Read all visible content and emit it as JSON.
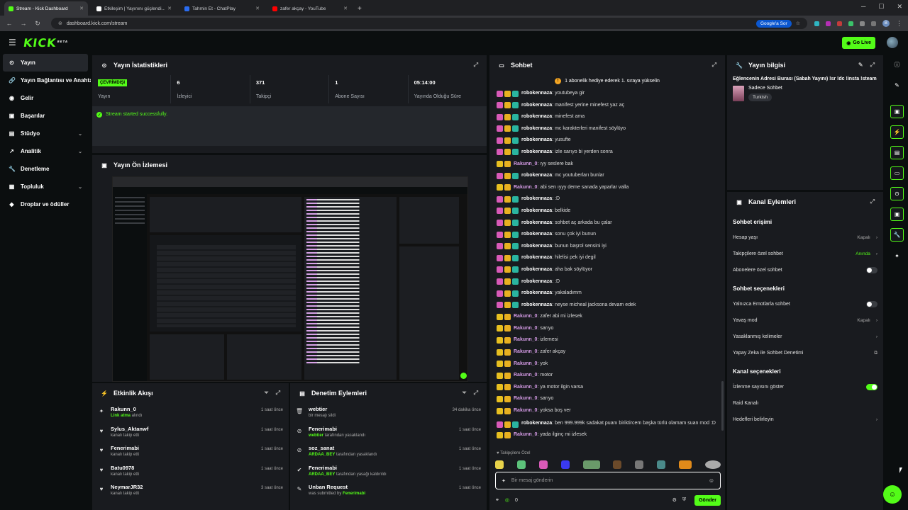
{
  "browser": {
    "tabs": [
      {
        "title": "Stream - Kick Dashboard",
        "fav": "#53fc18",
        "active": true
      },
      {
        "title": "Etkileşim | Yayınını güçlendi...",
        "fav": "#ffffff",
        "active": false
      },
      {
        "title": "Tahmin Et - ChatPlay",
        "fav": "#2a6cf0",
        "active": false
      },
      {
        "title": "zafer akçay - YouTube",
        "fav": "#ff0000",
        "active": false
      }
    ],
    "url": "dashboard.kick.com/stream",
    "google_button": "Google'a Sor",
    "profile_initial": "B"
  },
  "header": {
    "logo": "KICK",
    "logo_sup": "BETA",
    "go_live": "Go Live"
  },
  "sidebar": {
    "items": [
      {
        "label": "Yayın",
        "icon": "⊙",
        "active": true
      },
      {
        "label": "Yayın Bağlantısı ve Anahtarı",
        "icon": "🔗"
      },
      {
        "label": "Gelir",
        "icon": "◉"
      },
      {
        "label": "Başarılar",
        "icon": "▣"
      },
      {
        "label": "Stüdyo",
        "icon": "▤",
        "chevron": true
      },
      {
        "label": "Analitik",
        "icon": "↗",
        "chevron": true
      },
      {
        "label": "Denetleme",
        "icon": "🔧"
      },
      {
        "label": "Topluluk",
        "icon": "▦",
        "chevron": true
      },
      {
        "label": "Droplar ve ödüller",
        "icon": "◆"
      }
    ]
  },
  "stats": {
    "title": "Yayın İstatistikleri",
    "status_badge": "ÇEVRİMDIŞI",
    "status_label": "Yayın",
    "items": [
      {
        "value": "6",
        "label": "İzleyici"
      },
      {
        "value": "371",
        "label": "Takipçi"
      },
      {
        "value": "1",
        "label": "Abone Sayısı"
      },
      {
        "value": "05:14:00",
        "label": "Yayında Olduğu Süre"
      }
    ],
    "message": "Stream started successfully."
  },
  "preview": {
    "title": "Yayın Ön İzlemesi"
  },
  "activity": {
    "title": "Etkinlik Akışı",
    "items": [
      {
        "name": "Rakunn_0",
        "desc_hl": "Link atma",
        "desc": " alındı",
        "time": "1 saat önce",
        "icon": "✦"
      },
      {
        "name": "Sylus_Aktanwf",
        "desc_hl": "",
        "desc": "kanalı takip etti",
        "time": "1 saat önce",
        "icon": "♥"
      },
      {
        "name": "Fenerimabi",
        "desc_hl": "",
        "desc": "kanalı takip etti",
        "time": "1 saat önce",
        "icon": "♥"
      },
      {
        "name": "Batu0978",
        "desc_hl": "",
        "desc": "kanalı takip etti",
        "time": "1 saat önce",
        "icon": "♥"
      },
      {
        "name": "NeymarJR32",
        "desc_hl": "",
        "desc": "kanalı takip etti",
        "time": "3 saat önce",
        "icon": "♥"
      }
    ]
  },
  "moderation": {
    "title": "Denetim Eylemleri",
    "items": [
      {
        "name": "webtier",
        "desc_hl": "",
        "desc": "bir mesajı sildi",
        "time": "34 dakika önce",
        "icon": "🗑"
      },
      {
        "name": "Fenerimabi",
        "desc_hl": "webtier",
        "desc": " tarafından yasaklandı",
        "time": "1 saat önce",
        "icon": "⊘"
      },
      {
        "name": "soz_sanat",
        "desc_hl": "ARDAA_BEY",
        "desc": " tarafından yasaklandı",
        "time": "1 saat önce",
        "icon": "⊘"
      },
      {
        "name": "Fenerimabi",
        "desc_hl": "ARDAA_BEY",
        "desc": " tarafından yasağı kaldırıldı",
        "time": "1 saat önce",
        "icon": "✔"
      },
      {
        "name": "Unban Request",
        "desc_hl": "Fenerimabi",
        "desc": "was submitted by ",
        "time": "1 saat önce",
        "icon": "✎",
        "hl_after": true
      }
    ]
  },
  "chat": {
    "title": "Sohbet",
    "pinned": "1 abonelik hediye ederek 1. sıraya yükselin",
    "followers_only": "Takipçilere Özel",
    "input_placeholder": "Bir mesaj gönderin",
    "points": "0",
    "send": "Gönder",
    "messages": [
      {
        "user": "robokennaza",
        "text": "youtubeya gir",
        "color": "#ffffff"
      },
      {
        "user": "robokennaza",
        "text": "manifest yerine minefest yaz aç",
        "color": "#ffffff"
      },
      {
        "user": "robokennaza",
        "text": "minefest ama",
        "color": "#ffffff"
      },
      {
        "user": "robokennaza",
        "text": "mc karakterleri manifest söylüyo",
        "color": "#ffffff"
      },
      {
        "user": "robokennaza",
        "text": "yusufte",
        "color": "#ffffff"
      },
      {
        "user": "robokennaza",
        "text": "izle sarıyo bi yerden sonra",
        "color": "#ffffff"
      },
      {
        "user": "Rakunn_0",
        "text": "ıyy seslere bak",
        "color": "#d59be6"
      },
      {
        "user": "robokennaza",
        "text": "mc youtuberları bunlar",
        "color": "#ffffff"
      },
      {
        "user": "Rakunn_0",
        "text": "abi sen ıyyy deme sanada yaparlar valla",
        "color": "#d59be6"
      },
      {
        "user": "robokennaza",
        "text": ":D",
        "color": "#ffffff"
      },
      {
        "user": "robokennaza",
        "text": "belkide",
        "color": "#ffffff"
      },
      {
        "user": "robokennaza",
        "text": "sohbet aç arkada bu çalar",
        "color": "#ffffff"
      },
      {
        "user": "robokennaza",
        "text": "sonu çok iyi bunun",
        "color": "#ffffff"
      },
      {
        "user": "robokennaza",
        "text": "bunun başrol sensini iyi",
        "color": "#ffffff"
      },
      {
        "user": "robokennaza",
        "text": "hilelisi pek iyi degil",
        "color": "#ffffff"
      },
      {
        "user": "robokennaza",
        "text": "aha bak söylüyor",
        "color": "#ffffff"
      },
      {
        "user": "robokennaza",
        "text": ":D",
        "color": "#ffffff"
      },
      {
        "user": "robokennaza",
        "text": "yakaladımm",
        "color": "#ffffff"
      },
      {
        "user": "robokennaza",
        "text": "neyse micheal jacksona devam edek",
        "color": "#ffffff"
      },
      {
        "user": "Rakunn_0",
        "text": "zafer abi mi izlesek",
        "color": "#d59be6"
      },
      {
        "user": "Rakunn_0",
        "text": "sarıyo",
        "color": "#d59be6"
      },
      {
        "user": "Rakunn_0",
        "text": "izlemesi",
        "color": "#d59be6"
      },
      {
        "user": "Rakunn_0",
        "text": "zafer akçay",
        "color": "#d59be6"
      },
      {
        "user": "Rakunn_0",
        "text": "yok",
        "color": "#d59be6"
      },
      {
        "user": "Rakunn_0",
        "text": "motor",
        "color": "#d59be6"
      },
      {
        "user": "Rakunn_0",
        "text": "ya motor ilgin varsa",
        "color": "#d59be6"
      },
      {
        "user": "Rakunn_0",
        "text": "sarıyo",
        "color": "#d59be6"
      },
      {
        "user": "Rakunn_0",
        "text": "yoksa boş ver",
        "color": "#d59be6"
      },
      {
        "user": "robokennaza",
        "text": "ben 999.999k sadakat puanı biriktircem başka türlü olamam suan mod :D",
        "color": "#ffffff"
      },
      {
        "user": "Rakunn_0",
        "text": "yada ilginç mi izlesek",
        "color": "#d59be6"
      }
    ]
  },
  "stream_info": {
    "title": "Yayın bilgisi",
    "stream_title": "Eğlencenin Adresi Burası (Sabah Yayını) !sr !dc !insta !steam",
    "category": "Sadece Sohbet",
    "tag": "Turkish"
  },
  "channel_actions": {
    "title": "Kanal Eylemleri",
    "chat_access": "Sohbet erişimi",
    "account_age": "Hesap yaşı",
    "account_age_value": "Kapalı",
    "followers_only": "Takipçilere özel sohbet",
    "followers_only_value": "Anında",
    "subs_only": "Abonelere özel sohbet",
    "chat_options": "Sohbet seçenekleri",
    "emotes_only": "Yalnızca Emotlarla sohbet",
    "slow_mode": "Yavaş mod",
    "slow_mode_value": "Kapalı",
    "banned_words": "Yasaklanmış kelimeler",
    "ai_moderation": "Yapay Zeka ile Sohbet Denetimi",
    "channel_options": "Kanal seçenekleri",
    "show_viewers": "İzlenme sayısını göster",
    "raid_channel": "Raid Kanalı",
    "set_goals": "Hedefleri belirleyin"
  }
}
